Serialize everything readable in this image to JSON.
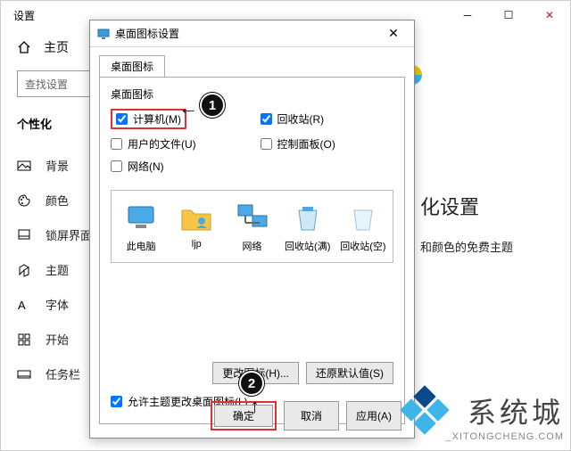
{
  "settings": {
    "window_title": "设置",
    "home": "主页",
    "search_placeholder": "查找设置",
    "section": "个性化",
    "nav": [
      {
        "label": "背景"
      },
      {
        "label": "颜色"
      },
      {
        "label": "锁屏界面"
      },
      {
        "label": "主题"
      },
      {
        "label": "字体"
      },
      {
        "label": "开始"
      },
      {
        "label": "任务栏"
      }
    ],
    "main_heading_partial": "化设置",
    "main_subtext_partial": "和颜色的免费主题"
  },
  "dialog": {
    "title": "桌面图标设置",
    "tab": "桌面图标",
    "group_label": "桌面图标",
    "checkboxes": {
      "computer": {
        "label": "计算机(M)",
        "checked": true
      },
      "recycle": {
        "label": "回收站(R)",
        "checked": true
      },
      "userfiles": {
        "label": "用户的文件(U)",
        "checked": false
      },
      "controlpanel": {
        "label": "控制面板(O)",
        "checked": false
      },
      "network": {
        "label": "网络(N)",
        "checked": false
      }
    },
    "icons": [
      {
        "label": "此电脑"
      },
      {
        "label": "ljp"
      },
      {
        "label": "网络"
      },
      {
        "label": "回收站(满)"
      },
      {
        "label": "回收站(空)"
      }
    ],
    "change_icon": "更改图标(H)...",
    "restore_default": "还原默认值(S)",
    "allow_themes": {
      "label": "允许主题更改桌面图标(L)",
      "checked": true
    },
    "ok": "确定",
    "cancel": "取消",
    "apply": "应用(A)"
  },
  "annotations": {
    "step1": "1",
    "step2": "2"
  },
  "watermark": {
    "cn": "系统城",
    "en": "_XITONGCHENG.COM"
  }
}
